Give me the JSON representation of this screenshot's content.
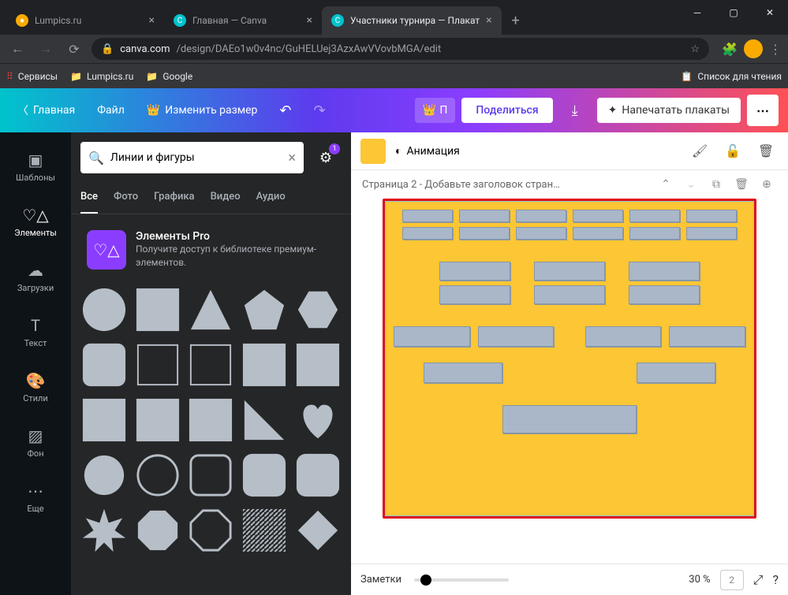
{
  "browser": {
    "tabs": [
      {
        "title": "Lumpics.ru",
        "favicon_color": "#f9ab00",
        "active": false
      },
      {
        "title": "Главная — Canva",
        "favicon_color": "#00c4cc",
        "active": false
      },
      {
        "title": "Участники турнира — Плакат",
        "favicon_color": "#00c4cc",
        "active": true
      }
    ],
    "url_domain": "canva.com",
    "url_path": "/design/DAEo1w0v4nc/GuHELUej3AzxAwVVovbMGA/edit",
    "bookmarks": {
      "services": "Сервисы",
      "lumpics": "Lumpics.ru",
      "google": "Google",
      "reading_list": "Список для чтения"
    }
  },
  "canva": {
    "menu": {
      "home": "Главная",
      "file": "Файл",
      "resize": "Изменить размер"
    },
    "header": {
      "pro_short": "П",
      "share": "Поделиться",
      "print": "Напечатать плакаты"
    },
    "rail": {
      "templates": "Шаблоны",
      "elements": "Элементы",
      "uploads": "Загрузки",
      "text": "Текст",
      "styles": "Стили",
      "background": "Фон",
      "more": "Еще"
    },
    "panel": {
      "search_value": "Линии и фигуры",
      "filter_badge": "1",
      "tabs": {
        "all": "Все",
        "photo": "Фото",
        "graphics": "Графика",
        "video": "Видео",
        "audio": "Аудио"
      },
      "pro_banner": {
        "title": "Элементы Pro",
        "sub": "Получите доступ к библиотеке премиум-элементов."
      }
    },
    "toolbar": {
      "animation": "Анимация",
      "page_title": "Страница 2 - Добавьте заголовок стран…"
    },
    "bottom": {
      "notes": "Заметки",
      "zoom": "30 %",
      "page_count": "2"
    },
    "canvas": {
      "color": "#fcc634"
    }
  }
}
